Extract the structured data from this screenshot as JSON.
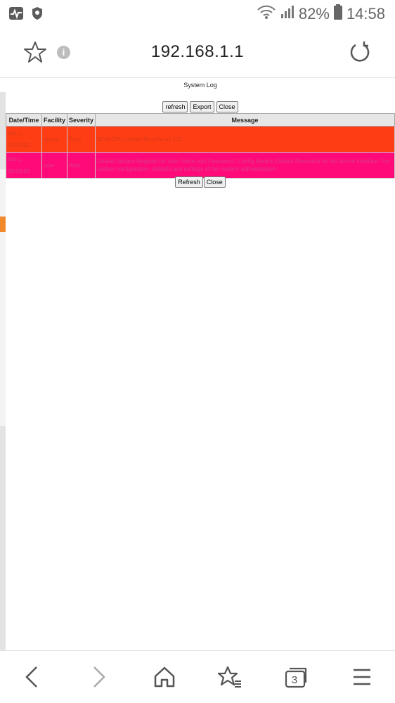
{
  "status_bar": {
    "battery_percent": "82%",
    "time": "14:58",
    "icons": [
      "activity-icon",
      "shield-icon",
      "wifi-icon",
      "signal-icon",
      "battery-icon"
    ]
  },
  "browser": {
    "url": "192.168.1.1",
    "tab_count": "3"
  },
  "page": {
    "title": "System Log",
    "top_buttons": [
      "refresh",
      "Export",
      "Close"
    ],
    "bottom_buttons": [
      "Refresh",
      "Close"
    ],
    "table": {
      "headers": [
        "Date/Time",
        "Facility",
        "Severity",
        "Message"
      ],
      "rows": [
        {
          "datetime": "Jan 1 00:00:21",
          "facility": "kernel",
          "severity": "Error",
          "message": "BCM CPU started BrcmFw v1.172",
          "color": "#ff3d14"
        },
        {
          "datetime": "Jan 1 00:00:26",
          "facility": "user",
          "severity": "Alert",
          "message": "Default Modem Register for User Name and Password / Config Modem Default Password for the device interface. For system configuration, defaults and settings of the modem administration.",
          "color": "#ff0a78"
        }
      ]
    }
  },
  "nav": {
    "icons": [
      "back-icon",
      "forward-icon",
      "home-icon",
      "bookmarks-icon",
      "tabs-icon",
      "menu-icon"
    ]
  }
}
